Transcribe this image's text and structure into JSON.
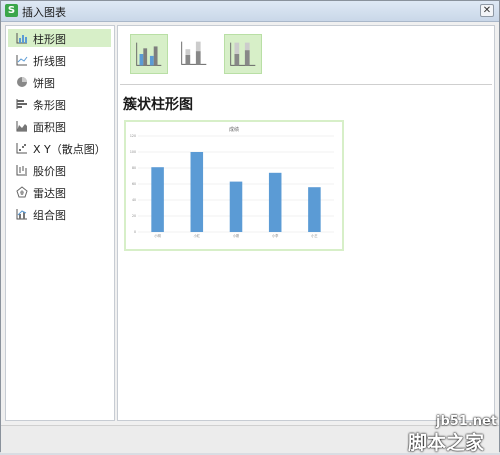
{
  "window": {
    "title": "插入图表",
    "app_icon_letter": "S",
    "close_glyph": "✕"
  },
  "sidebar": {
    "items": [
      {
        "label": "柱形图",
        "icon": "bar-chart-icon",
        "selected": true
      },
      {
        "label": "折线图",
        "icon": "line-chart-icon",
        "selected": false
      },
      {
        "label": "饼图",
        "icon": "pie-chart-icon",
        "selected": false
      },
      {
        "label": "条形图",
        "icon": "horizontal-bar-chart-icon",
        "selected": false
      },
      {
        "label": "面积图",
        "icon": "area-chart-icon",
        "selected": false
      },
      {
        "label": "X Y（散点图）",
        "icon": "scatter-chart-icon",
        "selected": false
      },
      {
        "label": "股价图",
        "icon": "stock-chart-icon",
        "selected": false
      },
      {
        "label": "雷达图",
        "icon": "radar-chart-icon",
        "selected": false
      },
      {
        "label": "组合图",
        "icon": "combo-chart-icon",
        "selected": false
      }
    ]
  },
  "main": {
    "subtypes": [
      {
        "icon": "clustered-column-icon",
        "selected": true
      },
      {
        "icon": "stacked-column-icon",
        "selected": false
      },
      {
        "icon": "percent-stacked-column-icon",
        "selected": true
      }
    ],
    "section_title": "簇状柱形图"
  },
  "colors": {
    "selection": "#d7efc8",
    "bar": "#5b9bd5",
    "accent_green": "#3aa64a"
  },
  "chart_data": {
    "type": "bar",
    "title": "成绩",
    "categories": [
      "小明",
      "小红",
      "小刚",
      "小李",
      "小王"
    ],
    "values": [
      81,
      100,
      63,
      74,
      56
    ],
    "ylim": [
      0,
      120
    ],
    "yticks": [
      "0",
      "20",
      "40",
      "60",
      "80",
      "100",
      "120"
    ],
    "grid": true
  },
  "watermark": {
    "site": "jb51.net",
    "name": "脚本之家"
  }
}
